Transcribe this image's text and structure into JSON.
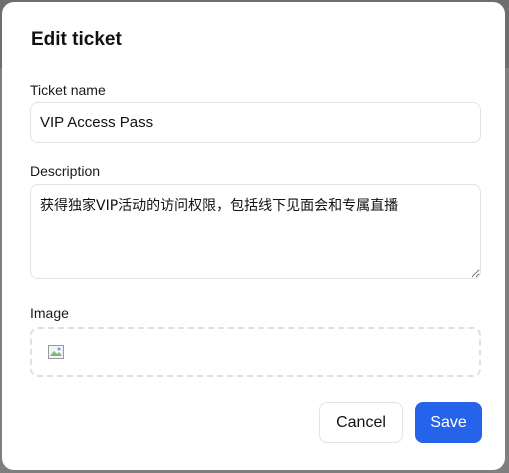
{
  "modal": {
    "title": "Edit ticket"
  },
  "form": {
    "name_label": "Ticket name",
    "name_value": "VIP Access Pass",
    "description_label": "Description",
    "description_value": "获得独家VIP活动的访问权限，包括线下见面会和专属直播",
    "image_label": "Image"
  },
  "actions": {
    "cancel_label": "Cancel",
    "save_label": "Save"
  },
  "colors": {
    "primary": "#2563eb",
    "border": "#e3e3e3",
    "overlay": "#7f7f7f"
  },
  "icons": {
    "image_placeholder": "broken-image-icon"
  }
}
